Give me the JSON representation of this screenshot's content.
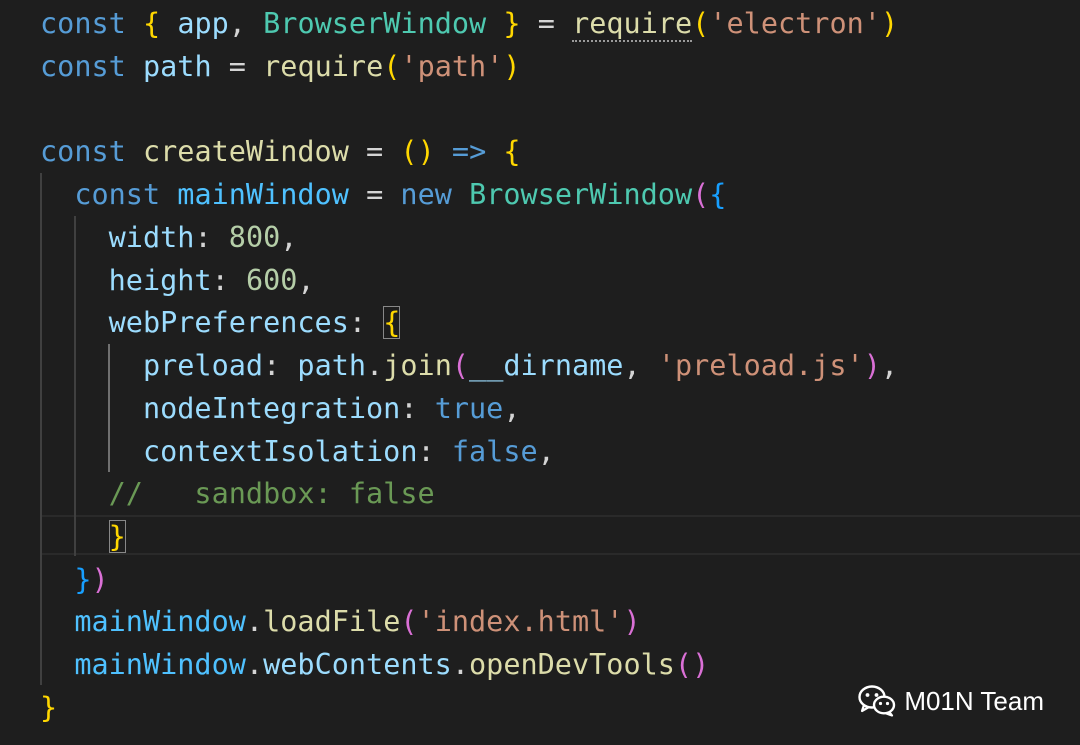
{
  "code_lines": [
    "const { app, BrowserWindow } = require('electron')",
    "const path = require('path')",
    "",
    "const createWindow = () => {",
    "  const mainWindow = new BrowserWindow({",
    "    width: 800,",
    "    height: 600,",
    "    webPreferences: {",
    "      preload: path.join(__dirname, 'preload.js'),",
    "      nodeIntegration: true,",
    "      contextIsolation: false,",
    "    //   sandbox: false",
    "    }",
    "  })",
    "  mainWindow.loadFile('index.html')",
    "  mainWindow.webContents.openDevTools()",
    "}"
  ],
  "tokens": {
    "l1": [
      "const",
      "{",
      "app",
      ",",
      "BrowserWindow",
      "}",
      "=",
      "require",
      "(",
      "'electron'",
      ")"
    ],
    "l2": [
      "const",
      "path",
      "=",
      "require",
      "(",
      "'path'",
      ")"
    ],
    "l4": [
      "const",
      "createWindow",
      "=",
      "(",
      ")",
      "=>",
      "{"
    ],
    "l5": [
      "const",
      "mainWindow",
      "=",
      "new",
      "BrowserWindow",
      "(",
      "{"
    ],
    "l6": [
      "width",
      ":",
      "800",
      ","
    ],
    "l7": [
      "height",
      ":",
      "600",
      ","
    ],
    "l8": [
      "webPreferences",
      ":",
      "{"
    ],
    "l9": [
      "preload",
      ":",
      "path",
      ".",
      "join",
      "(",
      "__dirname",
      ",",
      "'preload.js'",
      ")",
      ","
    ],
    "l10": [
      "nodeIntegration",
      ":",
      "true",
      ","
    ],
    "l11": [
      "contextIsolation",
      ":",
      "false",
      ","
    ],
    "l12": [
      "//   sandbox: false"
    ],
    "l13": [
      "}"
    ],
    "l14": [
      "}",
      ")"
    ],
    "l15": [
      "mainWindow",
      ".",
      "loadFile",
      "(",
      "'index.html'",
      ")"
    ],
    "l16": [
      "mainWindow",
      ".",
      "webContents",
      ".",
      "openDevTools",
      "(",
      ")"
    ],
    "l17": [
      "}"
    ]
  },
  "watermark": {
    "text": "M01N Team",
    "icon": "wechat-icon"
  },
  "colors": {
    "background": "#1e1e1e",
    "keyword": "#569cd6",
    "variable": "#9cdcfe",
    "class": "#4ec9b0",
    "function": "#dcdcaa",
    "string": "#ce9178",
    "number": "#b5cea8",
    "comment": "#6a9955",
    "bracket_1": "#ffd700",
    "bracket_2": "#da70d6",
    "bracket_3": "#179fff"
  }
}
